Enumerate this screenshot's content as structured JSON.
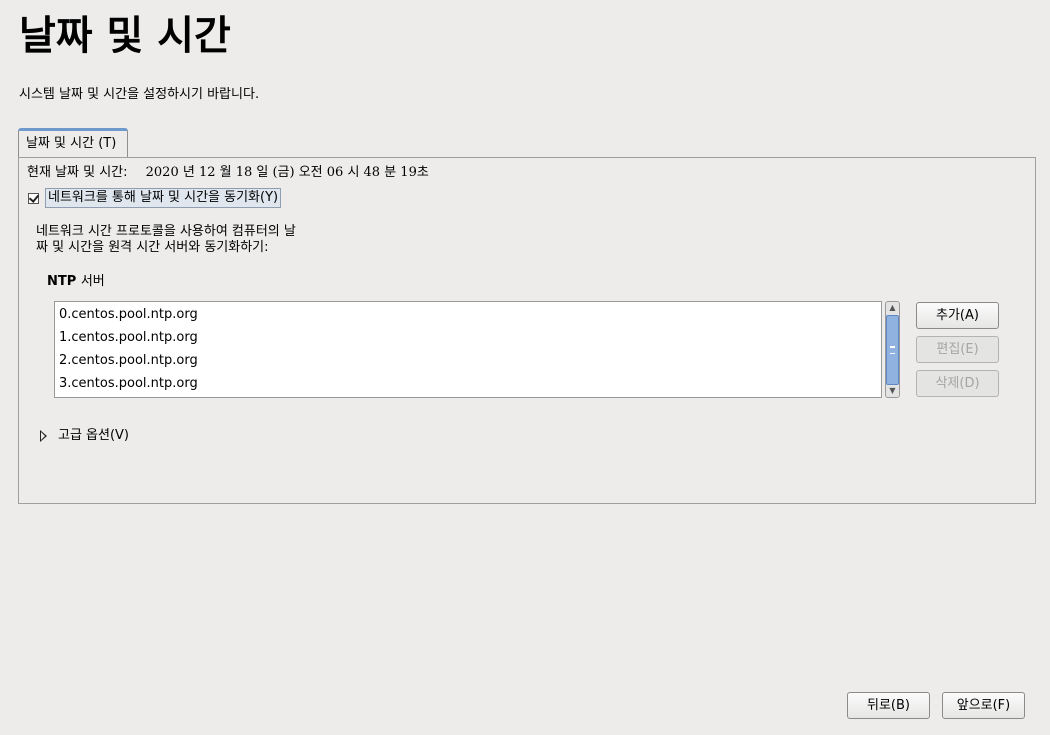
{
  "header": {
    "title": "날짜 및 시간",
    "subtitle": "시스템 날짜 및 시간을 설정하시기 바랍니다."
  },
  "tab": {
    "label": "날짜 및 시간 (T)"
  },
  "current_time": {
    "label": "현재 날짜 및 시간:",
    "value": "2020 년 12 월 18 일 (금) 오전 06 시 48 분 19초"
  },
  "sync": {
    "checked": true,
    "label": "네트워크를 통해 날짜 및 시간을 동기화(Y)"
  },
  "description": {
    "line1": "네트워크 시간 프로토콜을 사용하여 컴퓨터의 날",
    "line2": "짜 및 시간을 원격 시간 서버와 동기화하기:"
  },
  "ntp": {
    "heading_prefix": "NTP",
    "heading_suffix": "서버",
    "servers": [
      "0.centos.pool.ntp.org",
      "1.centos.pool.ntp.org",
      "2.centos.pool.ntp.org",
      "3.centos.pool.ntp.org"
    ],
    "add_label": "추가(A)",
    "edit_label": "편집(E)",
    "delete_label": "삭제(D)"
  },
  "advanced": {
    "label": "고급 옵션(V)"
  },
  "footer": {
    "back_label": "뒤로(B)",
    "next_label": "앞으로(F)"
  }
}
